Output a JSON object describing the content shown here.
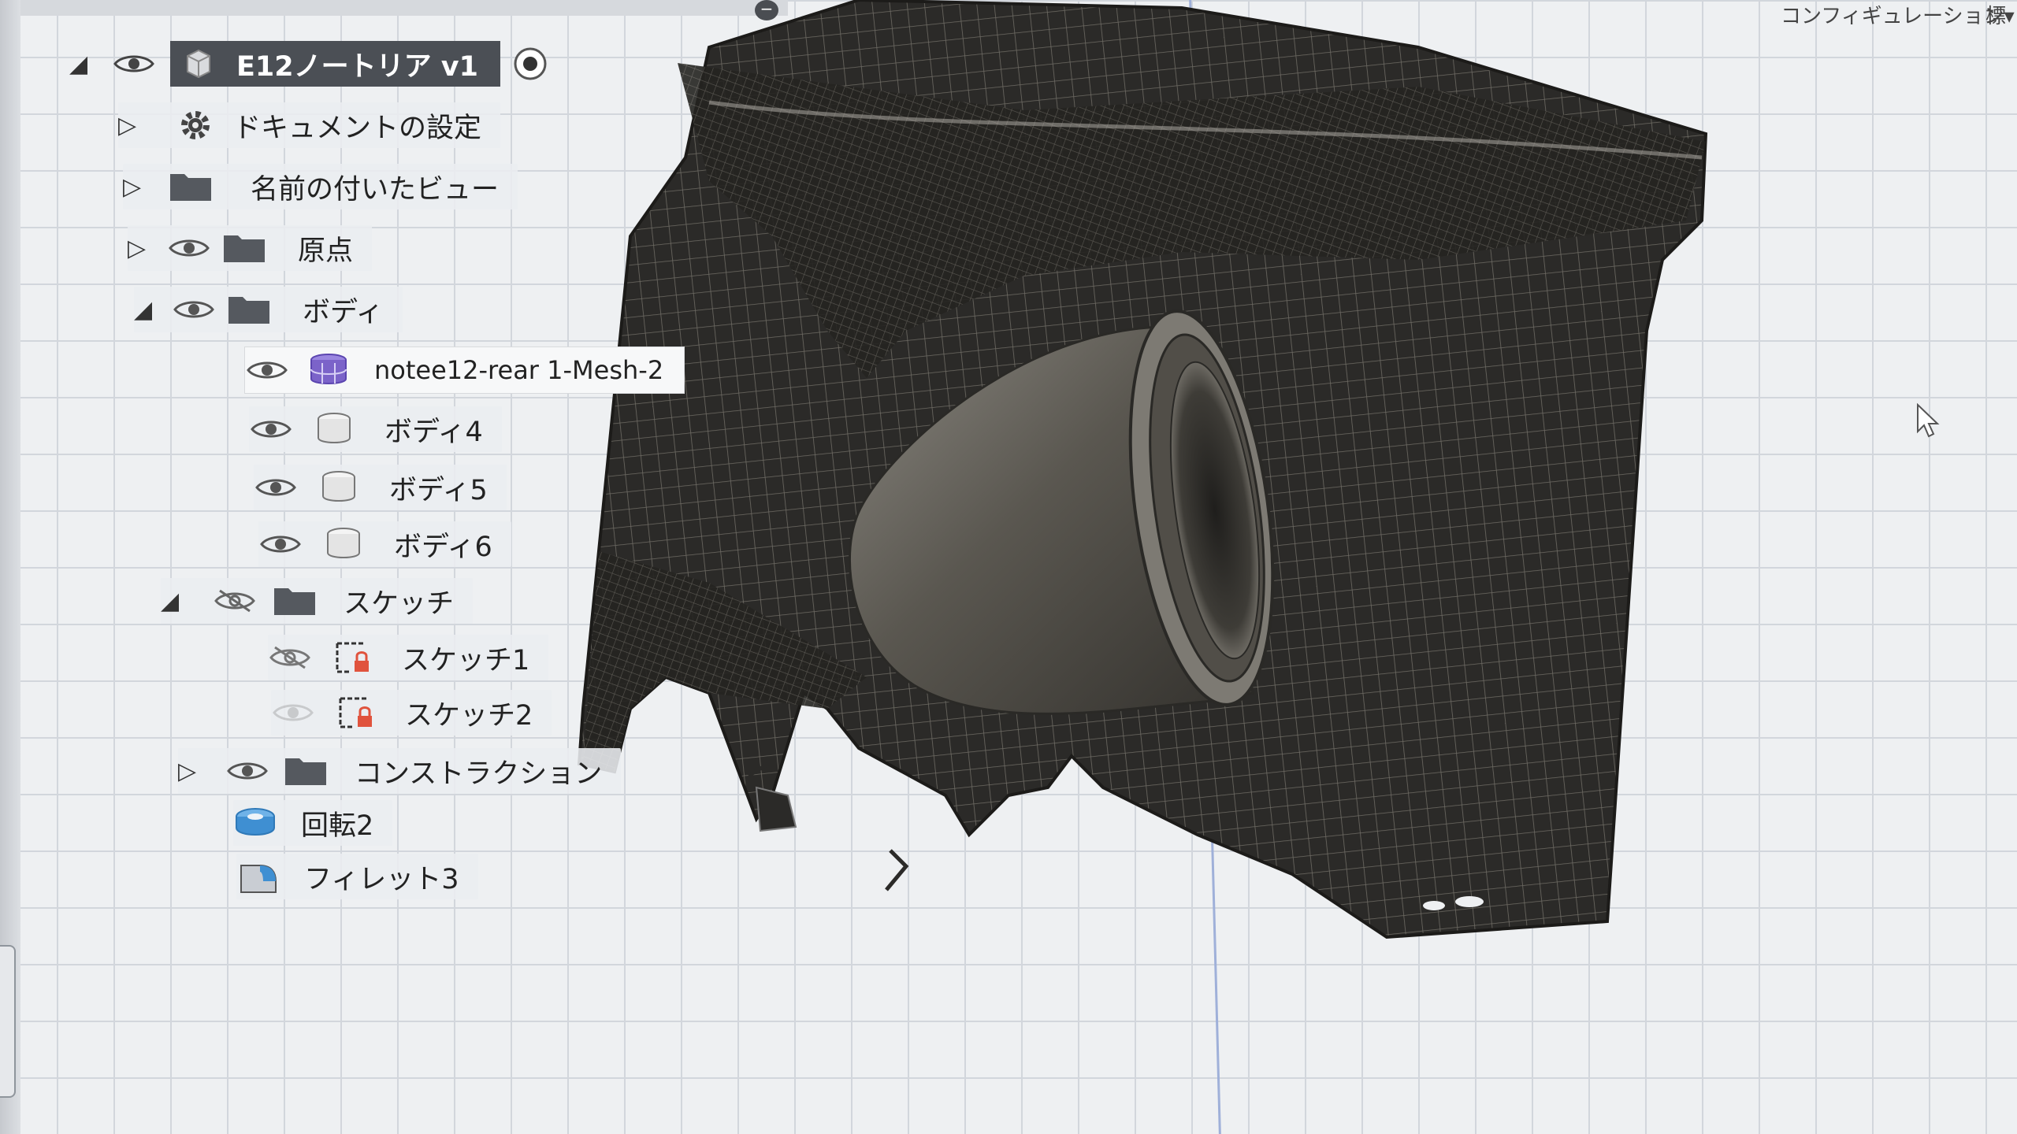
{
  "viewport": {
    "top_menu_label": "コンフィギュレーション▾",
    "top_menu_label_2": "標",
    "collapse_button": "−"
  },
  "browser": {
    "root": {
      "label": "E12ノートリア v1",
      "expanded": true
    },
    "items": [
      {
        "label": "ドキュメントの設定",
        "icon": "gear-icon",
        "expanded": false
      },
      {
        "label": "名前の付いたビュー",
        "icon": "folder-icon",
        "expanded": false
      },
      {
        "label": "原点",
        "icon": "folder-icon",
        "visible": true,
        "expanded": false
      },
      {
        "label": "ボディ",
        "icon": "folder-icon",
        "visible": true,
        "expanded": true
      },
      {
        "label": "notee12-rear 1-Mesh-2",
        "icon": "mesh-body-icon",
        "visible": true
      },
      {
        "label": "ボディ4",
        "icon": "solid-body-icon",
        "visible": true
      },
      {
        "label": "ボディ5",
        "icon": "solid-body-icon",
        "visible": true
      },
      {
        "label": "ボディ6",
        "icon": "solid-body-icon",
        "visible": true
      },
      {
        "label": "スケッチ",
        "icon": "folder-icon",
        "visible": false,
        "expanded": true
      },
      {
        "label": "スケッチ1",
        "icon": "sketch-icon",
        "visible": false
      },
      {
        "label": "スケッチ2",
        "icon": "sketch-icon",
        "visible": false
      },
      {
        "label": "コンストラクション",
        "icon": "folder-icon",
        "visible": true,
        "expanded": false
      },
      {
        "label": "回転2",
        "icon": "revolve-icon"
      },
      {
        "label": "フィレット3",
        "icon": "fillet-icon"
      }
    ]
  },
  "colors": {
    "viewport_bg": "#eef0f2",
    "grid": "#d2d6dc",
    "mesh_dark": "#2b2a28",
    "mesh_line": "#6e6b64",
    "nozzle": "#5d5a52",
    "root_bg": "#4b4f55",
    "mesh_icon": "#7b63c9"
  }
}
